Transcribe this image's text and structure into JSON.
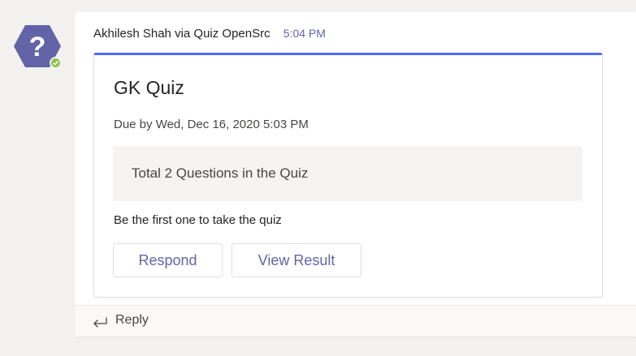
{
  "avatar": {
    "icon": "question-mark-icon",
    "glyph": "?",
    "color": "#6264a7",
    "presence_color": "#92c353"
  },
  "message": {
    "sender": "Akhilesh Shah via Quiz OpenSrc",
    "time": "5:04 PM"
  },
  "card": {
    "title": "GK Quiz",
    "due": "Due by Wed, Dec 16, 2020 5:03 PM",
    "info": "Total 2 Questions in the Quiz",
    "first_text": "Be the first one to take the quiz",
    "respond_label": "Respond",
    "view_result_label": "View Result",
    "accent_color": "#4f6bed"
  },
  "reply": {
    "label": "Reply",
    "icon": "reply-arrow-icon"
  }
}
